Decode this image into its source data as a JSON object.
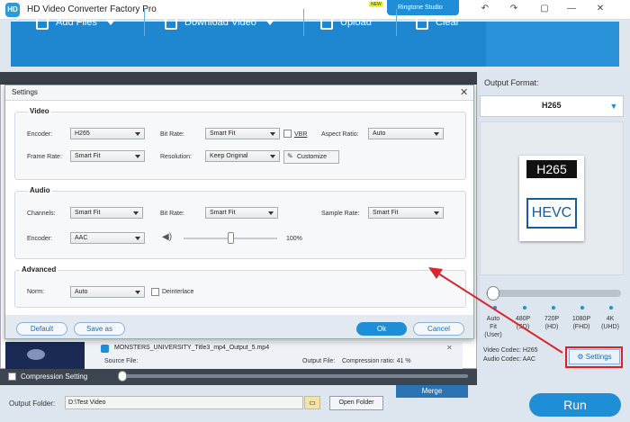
{
  "app": {
    "logo_text": "HD",
    "title": "HD Video Converter Factory Pro",
    "new_badge": "NEW",
    "ringtone_label": "Ringtone Studio"
  },
  "window_controls": {
    "back": "↶",
    "share": "↷",
    "chat": "▢",
    "minimize": "—",
    "close": "✕"
  },
  "toolbar": {
    "add_files": "Add Files",
    "download_video": "Download Video",
    "upload": "Upload",
    "clear": "Clear"
  },
  "output_format": {
    "label": "Output Format:",
    "selected": "H265",
    "badge_top": "H265",
    "badge_bottom": "HEVC",
    "quality_levels": [
      "Auto Fit (User)",
      "480P (SD)",
      "720P (HD)",
      "1080P (FHD)",
      "4K (UHD)"
    ],
    "video_codec": "Video Codec: H265",
    "audio_codec": "Audio Codec: AAC",
    "settings_button": "Settings"
  },
  "run_button": "Run",
  "file": {
    "name": "MONSTERS_UNIVERSITY_Title3_mp4_Output_5.mp4",
    "source_label": "Source File:",
    "output_label": "Output File:",
    "compression_ratio": "Compression ratio: 41 %"
  },
  "compression": {
    "label": "Compression Setting"
  },
  "bottom": {
    "output_folder_label": "Output Folder:",
    "folder_value": "D:\\Test Video",
    "open_folder": "Open Folder",
    "merge": "Merge"
  },
  "dialog": {
    "title": "Settings",
    "video": {
      "title": "Video",
      "encoder_label": "Encoder:",
      "encoder_value": "H265",
      "bitrate_label": "Bit Rate:",
      "bitrate_value": "Smart Fit",
      "vbr_label": "VBR",
      "aspect_label": "Aspect Ratio:",
      "aspect_value": "Auto",
      "framerate_label": "Frame Rate:",
      "framerate_value": "Smart Fit",
      "resolution_label": "Resolution:",
      "resolution_value": "Keep Original",
      "customize": "Customize"
    },
    "audio": {
      "title": "Audio",
      "channels_label": "Channels:",
      "channels_value": "Smart Fit",
      "bitrate_label": "Bit Rate:",
      "bitrate_value": "Smart Fit",
      "samplerate_label": "Sample Rate:",
      "samplerate_value": "Smart Fit",
      "encoder_label": "Encoder:",
      "encoder_value": "AAC",
      "volume": "100%"
    },
    "advanced": {
      "title": "Advanced",
      "norm_label": "Norm:",
      "norm_value": "Auto",
      "deinterlace_label": "Deinterlace"
    },
    "buttons": {
      "default": "Default",
      "save_as": "Save as",
      "ok": "Ok",
      "cancel": "Cancel"
    }
  }
}
